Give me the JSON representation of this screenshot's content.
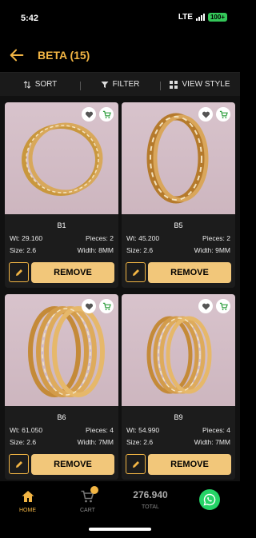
{
  "status_bar": {
    "time": "5:42",
    "network": "LTE",
    "battery": "100+"
  },
  "header": {
    "title": "BETA (15)",
    "back_icon": "arrow-left-icon"
  },
  "toolbar": {
    "sort_label": "SORT",
    "filter_label": "FILTER",
    "view_label": "VIEW STYLE"
  },
  "colors": {
    "accent": "#f2b544",
    "button": "#f2c77a",
    "favorite": "#555555",
    "cart": "#2e9e3d"
  },
  "products": [
    {
      "code": "B1",
      "weight": "Wt: 29.160",
      "pieces": "Pieces: 2",
      "size": "Size: 2.6",
      "width": "Width: 8MM",
      "remove_label": "REMOVE"
    },
    {
      "code": "B5",
      "weight": "Wt: 45.200",
      "pieces": "Pieces: 2",
      "size": "Size: 2.6",
      "width": "Width: 9MM",
      "remove_label": "REMOVE"
    },
    {
      "code": "B6",
      "weight": "Wt: 61.050",
      "pieces": "Pieces: 4",
      "size": "Size: 2.6",
      "width": "Width: 7MM",
      "remove_label": "REMOVE"
    },
    {
      "code": "B9",
      "weight": "Wt: 54.990",
      "pieces": "Pieces: 4",
      "size": "Size: 2.6",
      "width": "Width: 7MM",
      "remove_label": "REMOVE"
    }
  ],
  "bottom_nav": {
    "home_label": "HOME",
    "cart_label": "CART",
    "total_value": "276.940",
    "total_label": "TOTAL"
  }
}
